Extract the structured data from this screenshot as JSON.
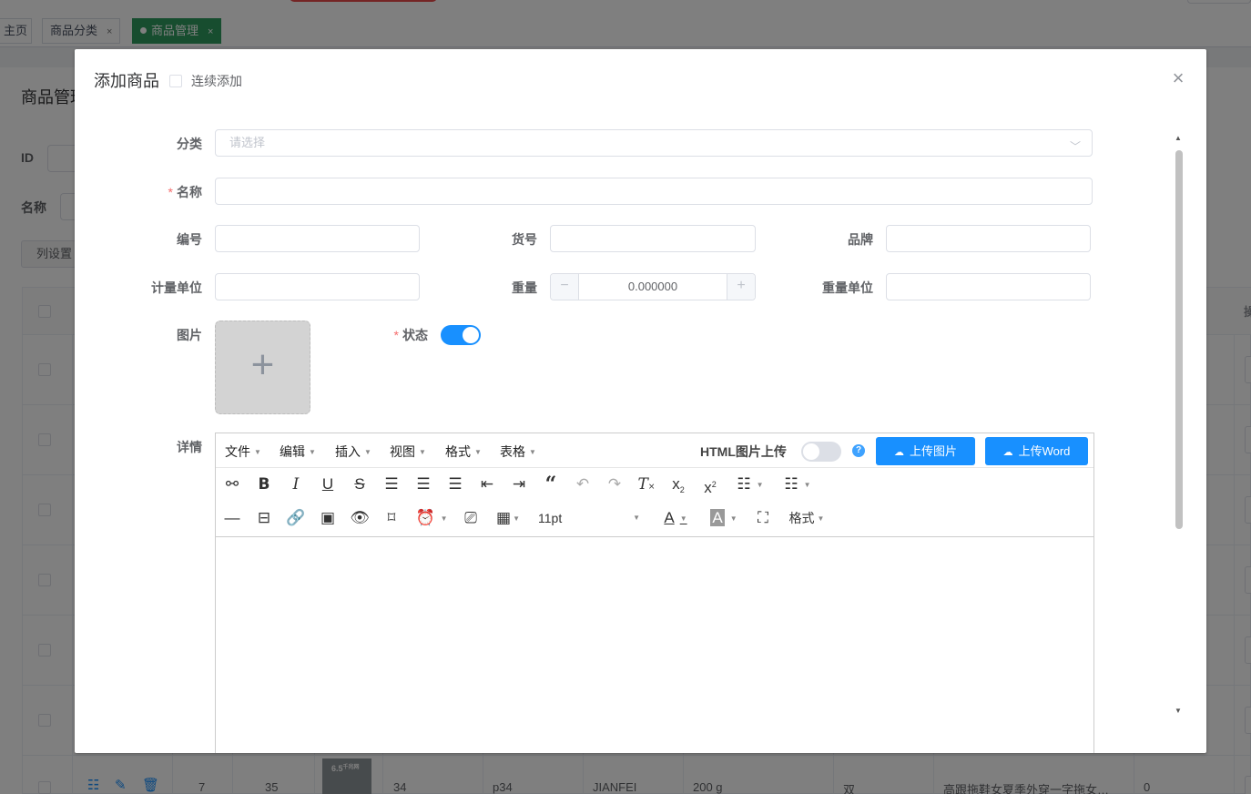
{
  "tabs": [
    {
      "label": "主页",
      "closable": false,
      "active": false
    },
    {
      "label": "商品分类",
      "closable": true,
      "active": false
    },
    {
      "label": "商品管理",
      "closable": true,
      "active": true
    }
  ],
  "background": {
    "page_title": "商品管理",
    "filter_labels": [
      "ID",
      "名称"
    ],
    "column_button": "列设置",
    "visible_row": {
      "cells": [
        "7",
        "35",
        "34",
        "p34",
        "JIANFEI",
        "200 g",
        "双",
        "高跟拖鞋女夏季外穿一字拖女…",
        "0"
      ],
      "thumb_text": "6.5",
      "thumb_sub": "千兆网"
    },
    "header_tail": "操"
  },
  "dialog": {
    "title": "添加商品",
    "continuous_add_label": "连续添加",
    "continuous_add_checked": false,
    "fields": {
      "category": {
        "label": "分类",
        "placeholder": "请选择"
      },
      "name": {
        "label": "名称",
        "required": true,
        "value": ""
      },
      "code": {
        "label": "编号",
        "value": ""
      },
      "item_no": {
        "label": "货号",
        "value": ""
      },
      "brand": {
        "label": "品牌",
        "value": ""
      },
      "unit": {
        "label": "计量单位",
        "value": ""
      },
      "weight": {
        "label": "重量",
        "value": "0.000000"
      },
      "weight_unit": {
        "label": "重量单位",
        "value": ""
      },
      "image": {
        "label": "图片"
      },
      "status": {
        "label": "状态",
        "required": true,
        "on": true
      },
      "detail": {
        "label": "详情"
      }
    },
    "editor": {
      "menus": [
        "文件",
        "编辑",
        "插入",
        "视图",
        "格式",
        "表格"
      ],
      "html_image_upload_label": "HTML图片上传",
      "html_image_upload_on": false,
      "upload_image_button": "上传图片",
      "upload_word_button": "上传Word",
      "font_size": "11pt",
      "format_label": "格式"
    }
  },
  "colors": {
    "primary": "#1890ff",
    "active_tab": "#2e9b5e",
    "required": "#f56c6c"
  }
}
